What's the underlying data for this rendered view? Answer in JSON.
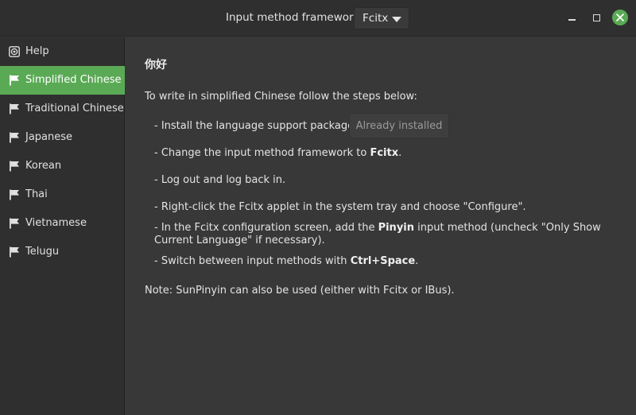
{
  "titlebar": {
    "framework_label": "Input method framework:",
    "framework_value": "Fcitx"
  },
  "sidebar": {
    "items": [
      {
        "label": "Help",
        "icon": "help-icon"
      },
      {
        "label": "Simplified Chinese",
        "icon": "flag-icon",
        "active": true
      },
      {
        "label": "Traditional Chinese",
        "icon": "flag-icon"
      },
      {
        "label": "Japanese",
        "icon": "flag-icon"
      },
      {
        "label": "Korean",
        "icon": "flag-icon"
      },
      {
        "label": "Thai",
        "icon": "flag-icon"
      },
      {
        "label": "Vietnamese",
        "icon": "flag-icon"
      },
      {
        "label": "Telugu",
        "icon": "flag-icon"
      }
    ]
  },
  "main": {
    "greeting": "你好",
    "intro": "To write in simplified Chinese follow the steps below:",
    "steps": {
      "s1": "- Install the language support packages:",
      "s1_button": "Already installed",
      "s2_pre": "- Change the input method framework to ",
      "s2_bold": "Fcitx",
      "s2_post": ".",
      "s3": "- Log out and log back in.",
      "s4": "- Right-click the Fcitx applet in the system tray and choose \"Configure\".",
      "s5_pre": "- In the Fcitx configuration screen, add the ",
      "s5_bold": "Pinyin",
      "s5_post": " input method (uncheck \"Only Show Current Language\" if necessary).",
      "s6_pre": "- Switch between input methods with ",
      "s6_bold": "Ctrl+Space",
      "s6_post": "."
    },
    "note": "Note: SunPinyin can also be used (either with Fcitx or IBus)."
  },
  "colors": {
    "accent": "#5aaa55",
    "background": "#383838",
    "sidebar": "#2f2f2f"
  }
}
